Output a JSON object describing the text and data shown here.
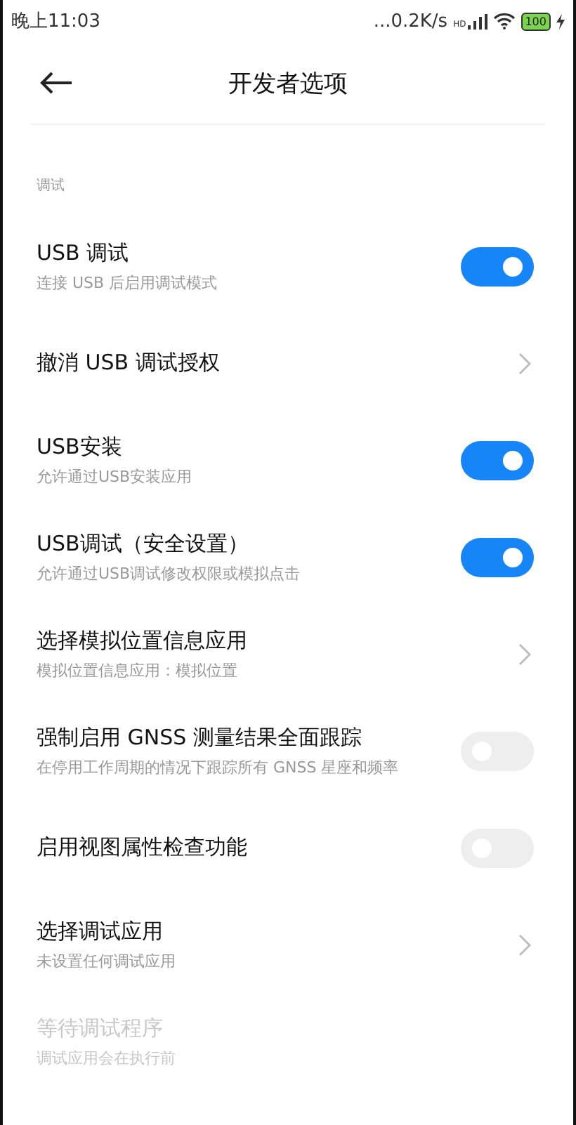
{
  "status_bar": {
    "time": "晚上11:03",
    "speed": "...0.2K/s",
    "network": "HD",
    "battery": "100"
  },
  "header": {
    "title": "开发者选项"
  },
  "section": {
    "title": "调试"
  },
  "items": [
    {
      "kind": "toggle",
      "title": "USB 调试",
      "subtitle": "连接 USB 后启用调试模式",
      "on": true,
      "disabled": false
    },
    {
      "kind": "link",
      "title": "撤消 USB 调试授权",
      "disabled": false
    },
    {
      "kind": "toggle",
      "title": "USB安装",
      "subtitle": "允许通过USB安装应用",
      "on": true,
      "disabled": false
    },
    {
      "kind": "toggle",
      "title": "USB调试（安全设置）",
      "subtitle": "允许通过USB调试修改权限或模拟点击",
      "on": true,
      "disabled": false
    },
    {
      "kind": "link",
      "title": "选择模拟位置信息应用",
      "subtitle": "模拟位置信息应用：模拟位置",
      "disabled": false
    },
    {
      "kind": "toggle",
      "title": "强制启用 GNSS 测量结果全面跟踪",
      "subtitle": "在停用工作周期的情况下跟踪所有 GNSS 星座和频率",
      "on": false,
      "disabled": false
    },
    {
      "kind": "toggle",
      "title": "启用视图属性检查功能",
      "on": false,
      "disabled": false
    },
    {
      "kind": "link",
      "title": "选择调试应用",
      "subtitle": "未设置任何调试应用",
      "disabled": false
    },
    {
      "kind": "plain",
      "title": "等待调试程序",
      "subtitle": "调试应用会在执行前",
      "disabled": true
    }
  ]
}
